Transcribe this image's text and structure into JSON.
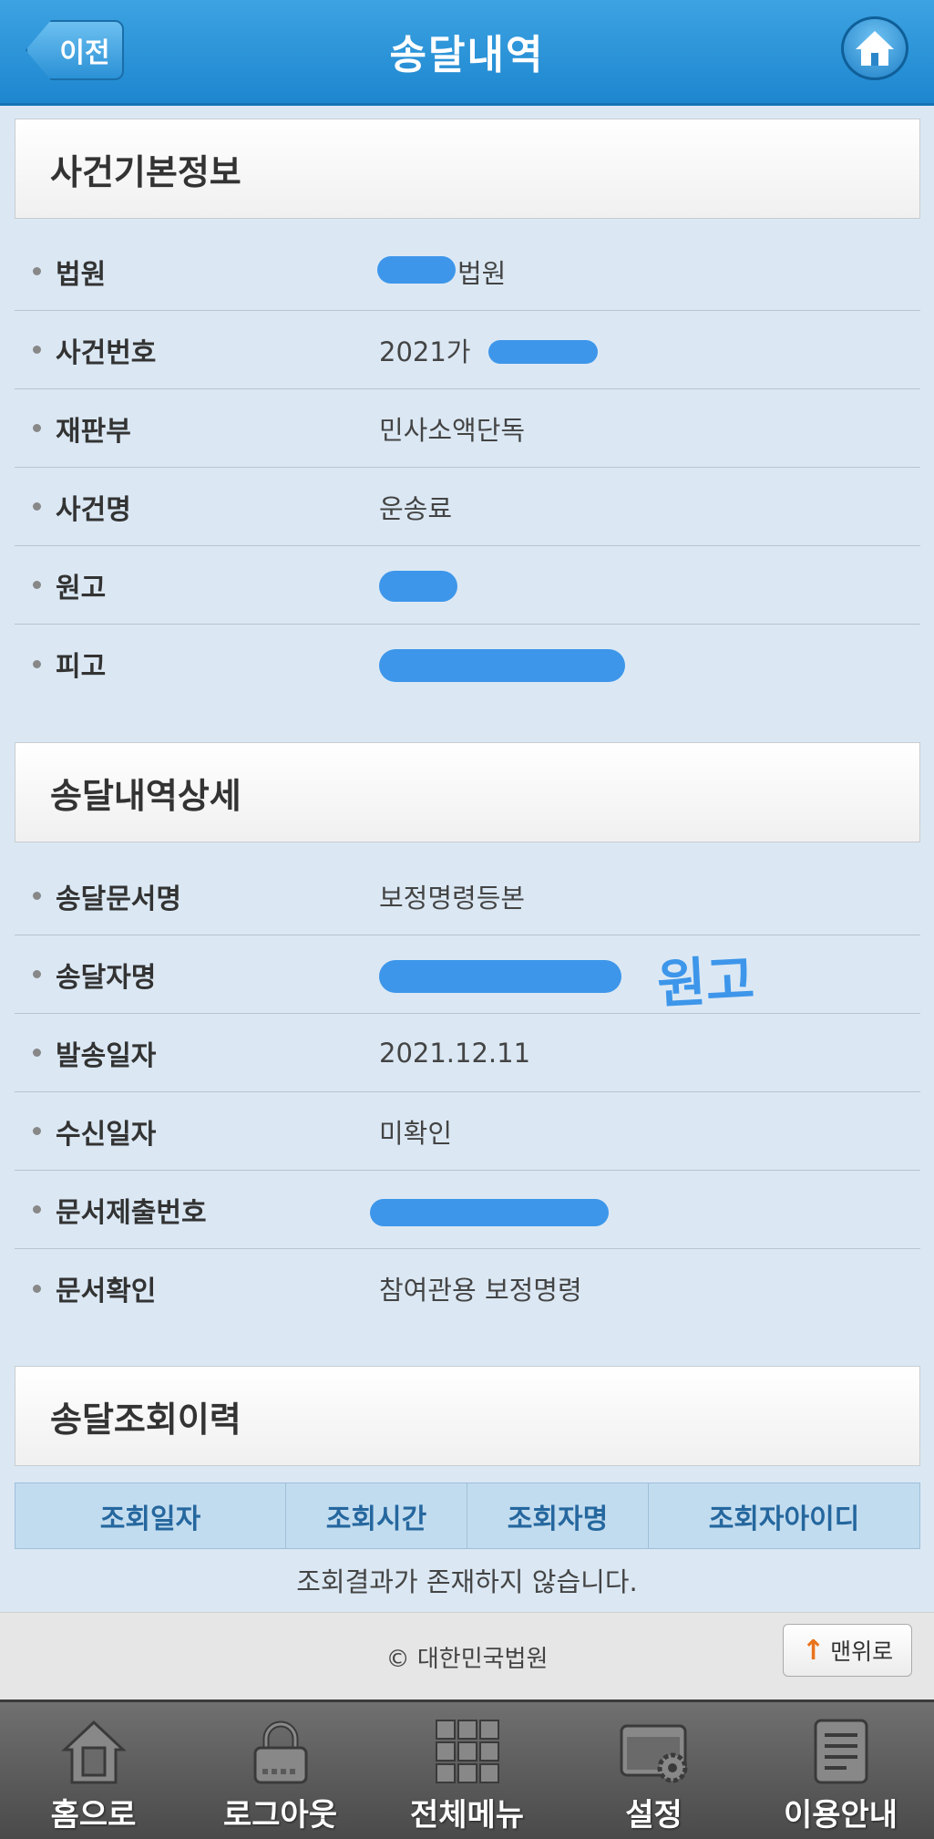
{
  "header": {
    "back_label": "이전",
    "title": "송달내역"
  },
  "case_info": {
    "title": "사건기본정보",
    "rows": [
      {
        "label": "법원",
        "value": "법원"
      },
      {
        "label": "사건번호",
        "value": "2021가"
      },
      {
        "label": "재판부",
        "value": "민사소액단독"
      },
      {
        "label": "사건명",
        "value": "운송료"
      },
      {
        "label": "원고",
        "value": ""
      },
      {
        "label": "피고",
        "value": ""
      }
    ]
  },
  "delivery_detail": {
    "title": "송달내역상세",
    "rows": [
      {
        "label": "송달문서명",
        "value": "보정명령등본"
      },
      {
        "label": "송달자명",
        "value": ""
      },
      {
        "label": "발송일자",
        "value": "2021.12.11"
      },
      {
        "label": "수신일자",
        "value": "미확인"
      },
      {
        "label": "문서제출번호",
        "value": ""
      },
      {
        "label": "문서확인",
        "value": "참여관용 보정명령"
      }
    ],
    "handwritten_note": "원고"
  },
  "history": {
    "title": "송달조회이력",
    "columns": [
      "조회일자",
      "조회시간",
      "조회자명",
      "조회자아이디"
    ],
    "empty_message": "조회결과가 존재하지 않습니다."
  },
  "footer": {
    "copyright": "© 대한민국법원",
    "top_button": "맨위로",
    "top_arrow": "↑"
  },
  "bottom_nav": [
    {
      "label": "홈으로",
      "icon": "home-icon"
    },
    {
      "label": "로그아웃",
      "icon": "lock-icon"
    },
    {
      "label": "전체메뉴",
      "icon": "grid-menu-icon"
    },
    {
      "label": "설정",
      "icon": "settings-icon"
    },
    {
      "label": "이용안내",
      "icon": "document-icon"
    }
  ],
  "colors": {
    "header": "#1d86cf",
    "background": "#dbe8f4",
    "redaction": "#3d96ea",
    "table_header": "#c2dcef"
  }
}
